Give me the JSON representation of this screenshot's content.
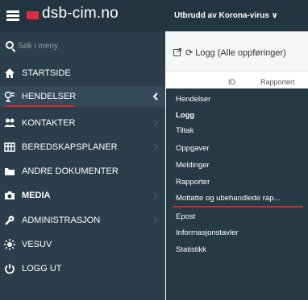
{
  "brand": {
    "name": "dsb-cim.no",
    "flag_color": "#e3283f"
  },
  "search": {
    "placeholder": "Søk i meny"
  },
  "sidebar": {
    "items": [
      {
        "label": "STARTSIDE",
        "icon": "home-icon"
      },
      {
        "label": "HENDELSER",
        "icon": "hendelser-icon"
      },
      {
        "label": "KONTAKTER",
        "icon": "contacts-icon"
      },
      {
        "label": "BEREDSKAPSPLANER",
        "icon": "plans-icon"
      },
      {
        "label": "ANDRE DOKUMENTER",
        "icon": "folder-icon"
      },
      {
        "label": "MEDIA",
        "icon": "camera-icon"
      },
      {
        "label": "ADMINISTRASJON",
        "icon": "wrench-icon"
      },
      {
        "label": "VESUV",
        "icon": "sun-icon"
      },
      {
        "label": "LOGG UT",
        "icon": "power-icon"
      }
    ]
  },
  "topbar": {
    "title": "Utbrudd av Korona-virus ∨"
  },
  "content": {
    "title": "Logg (Alle oppføringer)",
    "columns": [
      "ID",
      "Rapportert"
    ]
  },
  "dropdown": {
    "items": [
      "Hendelser",
      "Logg",
      "Tiltak",
      "Oppgaver",
      "Meldinger",
      "Rapporter",
      "Mottatte og ubehandlede rap...",
      "Epost",
      "Informasjonstavler",
      "Statistikk"
    ]
  },
  "colors": {
    "sidebar_bg": "#2a3f4b",
    "header_bg": "#223540",
    "dropdown_bg": "#263a45",
    "highlight": "#d42a2a"
  }
}
